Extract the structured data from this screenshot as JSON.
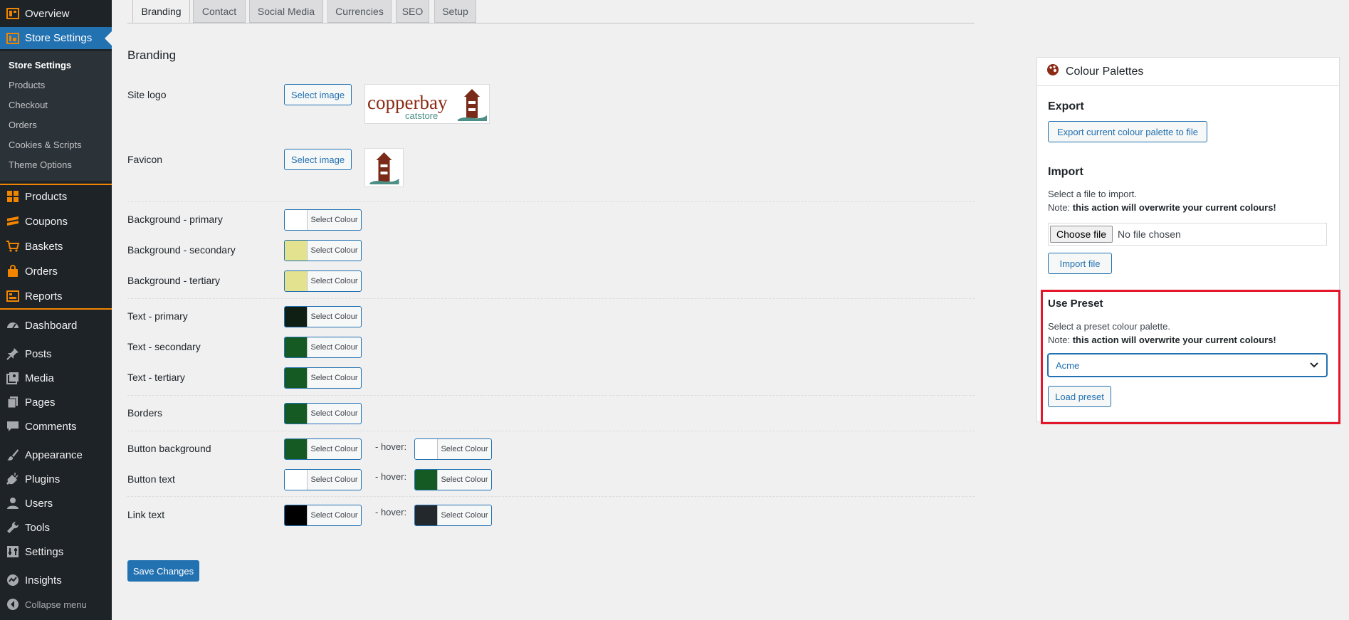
{
  "sidebar": {
    "overview": "Overview",
    "store_settings": "Store Settings",
    "submenu": [
      "Store Settings",
      "Products",
      "Checkout",
      "Orders",
      "Cookies & Scripts",
      "Theme Options"
    ],
    "store_items": [
      "Products",
      "Coupons",
      "Baskets",
      "Orders",
      "Reports"
    ],
    "wp_items": [
      "Dashboard",
      "Posts",
      "Media",
      "Pages",
      "Comments",
      "Appearance",
      "Plugins",
      "Users",
      "Tools",
      "Settings",
      "Insights"
    ],
    "collapse": "Collapse menu"
  },
  "tabs": [
    "Branding",
    "Contact",
    "Social Media",
    "Currencies",
    "SEO",
    "Setup"
  ],
  "branding": {
    "heading": "Branding",
    "site_logo": "Site logo",
    "favicon": "Favicon",
    "select_image": "Select image",
    "logo_text_main": "copperbay",
    "logo_text_sub": "catstore",
    "select_colour": "Select Colour",
    "hover": "- hover:",
    "rows": [
      {
        "label": "Background - primary",
        "color": "#ffffff"
      },
      {
        "label": "Background - secondary",
        "color": "#e3e38f"
      },
      {
        "label": "Background - tertiary",
        "color": "#e3e38f"
      },
      {
        "label": "Text - primary",
        "color": "#0f1f14"
      },
      {
        "label": "Text - secondary",
        "color": "#145a22"
      },
      {
        "label": "Text - tertiary",
        "color": "#145a22"
      },
      {
        "label": "Borders",
        "color": "#145a22"
      },
      {
        "label": "Button background",
        "color": "#145a22",
        "hover_color": "#ffffff"
      },
      {
        "label": "Button text",
        "color": "#ffffff",
        "hover_color": "#145a22"
      },
      {
        "label": "Link text",
        "color": "#000000",
        "hover_color": "#23282d"
      }
    ],
    "save": "Save Changes"
  },
  "palettes": {
    "title": "Colour Palettes",
    "export_heading": "Export",
    "export_button": "Export current colour palette to file",
    "import_heading": "Import",
    "import_text": "Select a file to import.",
    "note_prefix": "Note:",
    "note_bold": "this action will overwrite your current colours!",
    "choose_file": "Choose file",
    "no_file": "No file chosen",
    "import_button": "Import file",
    "preset_heading": "Use Preset",
    "preset_text": "Select a preset colour palette.",
    "preset_value": "Acme",
    "load_button": "Load preset"
  },
  "colors": {
    "accent": "#2271b1",
    "sidebar": "#1d2327",
    "highlight": "#e3162a",
    "orange": "#f18500"
  }
}
